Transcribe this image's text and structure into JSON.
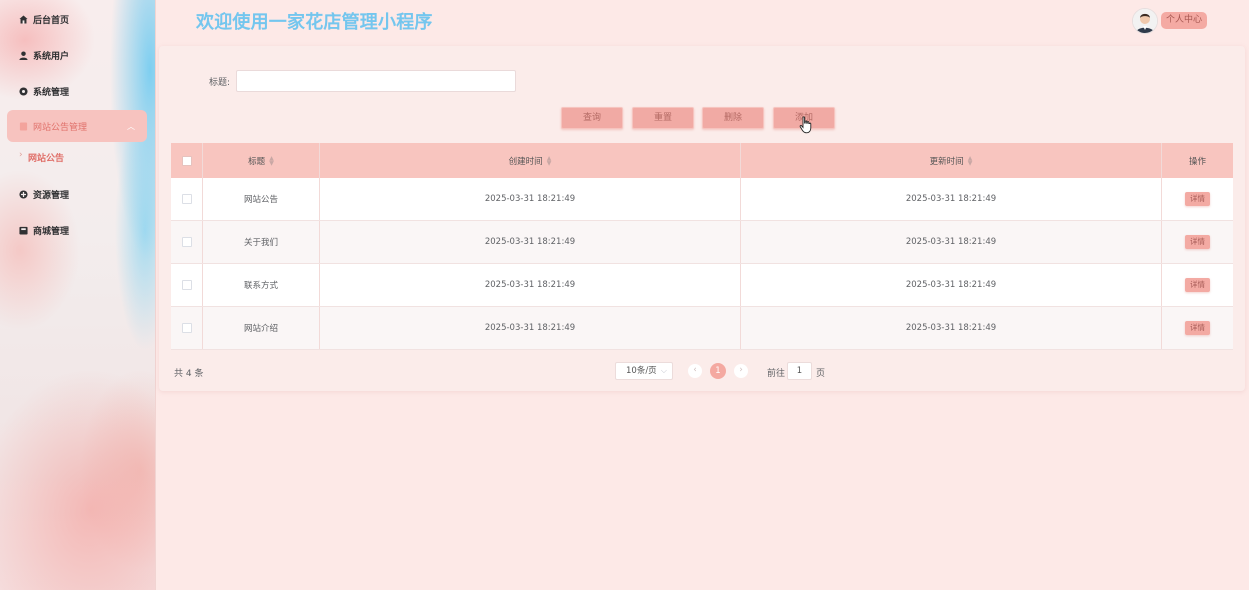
{
  "app": {
    "title": "欢迎使用一家花店管理小程序"
  },
  "header": {
    "profile_label": "个人中心"
  },
  "sidebar": {
    "items": [
      {
        "label": "后台首页",
        "icon": "home-icon"
      },
      {
        "label": "系统用户",
        "icon": "user-icon"
      },
      {
        "label": "系统管理",
        "icon": "gear-icon"
      },
      {
        "label": "网站公告管理",
        "icon": "notice-icon",
        "active": true
      },
      {
        "label": "资源管理",
        "icon": "plus-circle-icon"
      },
      {
        "label": "商城管理",
        "icon": "shop-icon"
      }
    ],
    "sub_item": {
      "label": "网站公告"
    }
  },
  "search": {
    "label": "标题:",
    "value": ""
  },
  "buttons": {
    "query": "查询",
    "reset": "重置",
    "delete": "删除",
    "add": "添加"
  },
  "table": {
    "headers": [
      "标题",
      "创建时间",
      "更新时间",
      "操作"
    ],
    "rows": [
      {
        "title": "网站公告",
        "created": "2025-03-31 18:21:49",
        "updated": "2025-03-31 18:21:49",
        "action": "详情"
      },
      {
        "title": "关于我们",
        "created": "2025-03-31 18:21:49",
        "updated": "2025-03-31 18:21:49",
        "action": "详情"
      },
      {
        "title": "联系方式",
        "created": "2025-03-31 18:21:49",
        "updated": "2025-03-31 18:21:49",
        "action": "详情"
      },
      {
        "title": "网站介绍",
        "created": "2025-03-31 18:21:49",
        "updated": "2025-03-31 18:21:49",
        "action": "详情"
      }
    ]
  },
  "pagination": {
    "total_text": "共 4 条",
    "page_size": "10条/页",
    "current_page": "1",
    "goto_label": "前往",
    "goto_value": "1",
    "page_unit": "页"
  },
  "colors": {
    "accent": "#f4a9a1",
    "title": "#74c6ee",
    "active_text": "#e0706a"
  }
}
